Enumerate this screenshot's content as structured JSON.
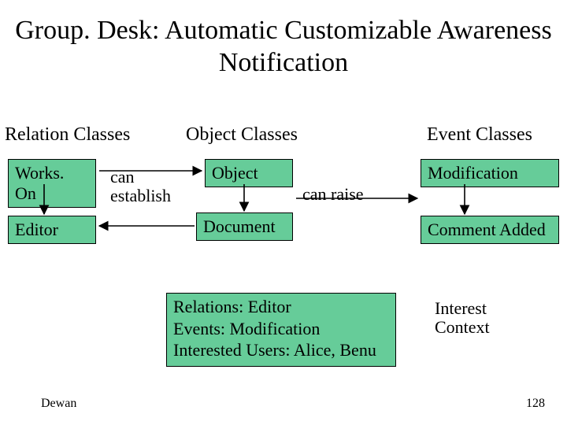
{
  "title": "Group. Desk: Automatic Customizable Awareness Notification",
  "columns": {
    "relation": "Relation Classes",
    "object": "Object Classes",
    "event": "Event Classes"
  },
  "boxes": {
    "works_on": "Works. On",
    "editor": "Editor",
    "object": "Object",
    "document": "Document",
    "modification": "Modification",
    "comment_added": "Comment Added"
  },
  "labels": {
    "can_establish_l1": "can",
    "can_establish_l2": "establish",
    "can_raise": "can raise"
  },
  "interest_box": {
    "l1": "Relations: Editor",
    "l2": "Events: Modification",
    "l3": "Interested Users: Alice, Benu"
  },
  "interest_title": {
    "l1": "Interest",
    "l2": "Context"
  },
  "footer": {
    "author": "Dewan",
    "page": "128"
  }
}
